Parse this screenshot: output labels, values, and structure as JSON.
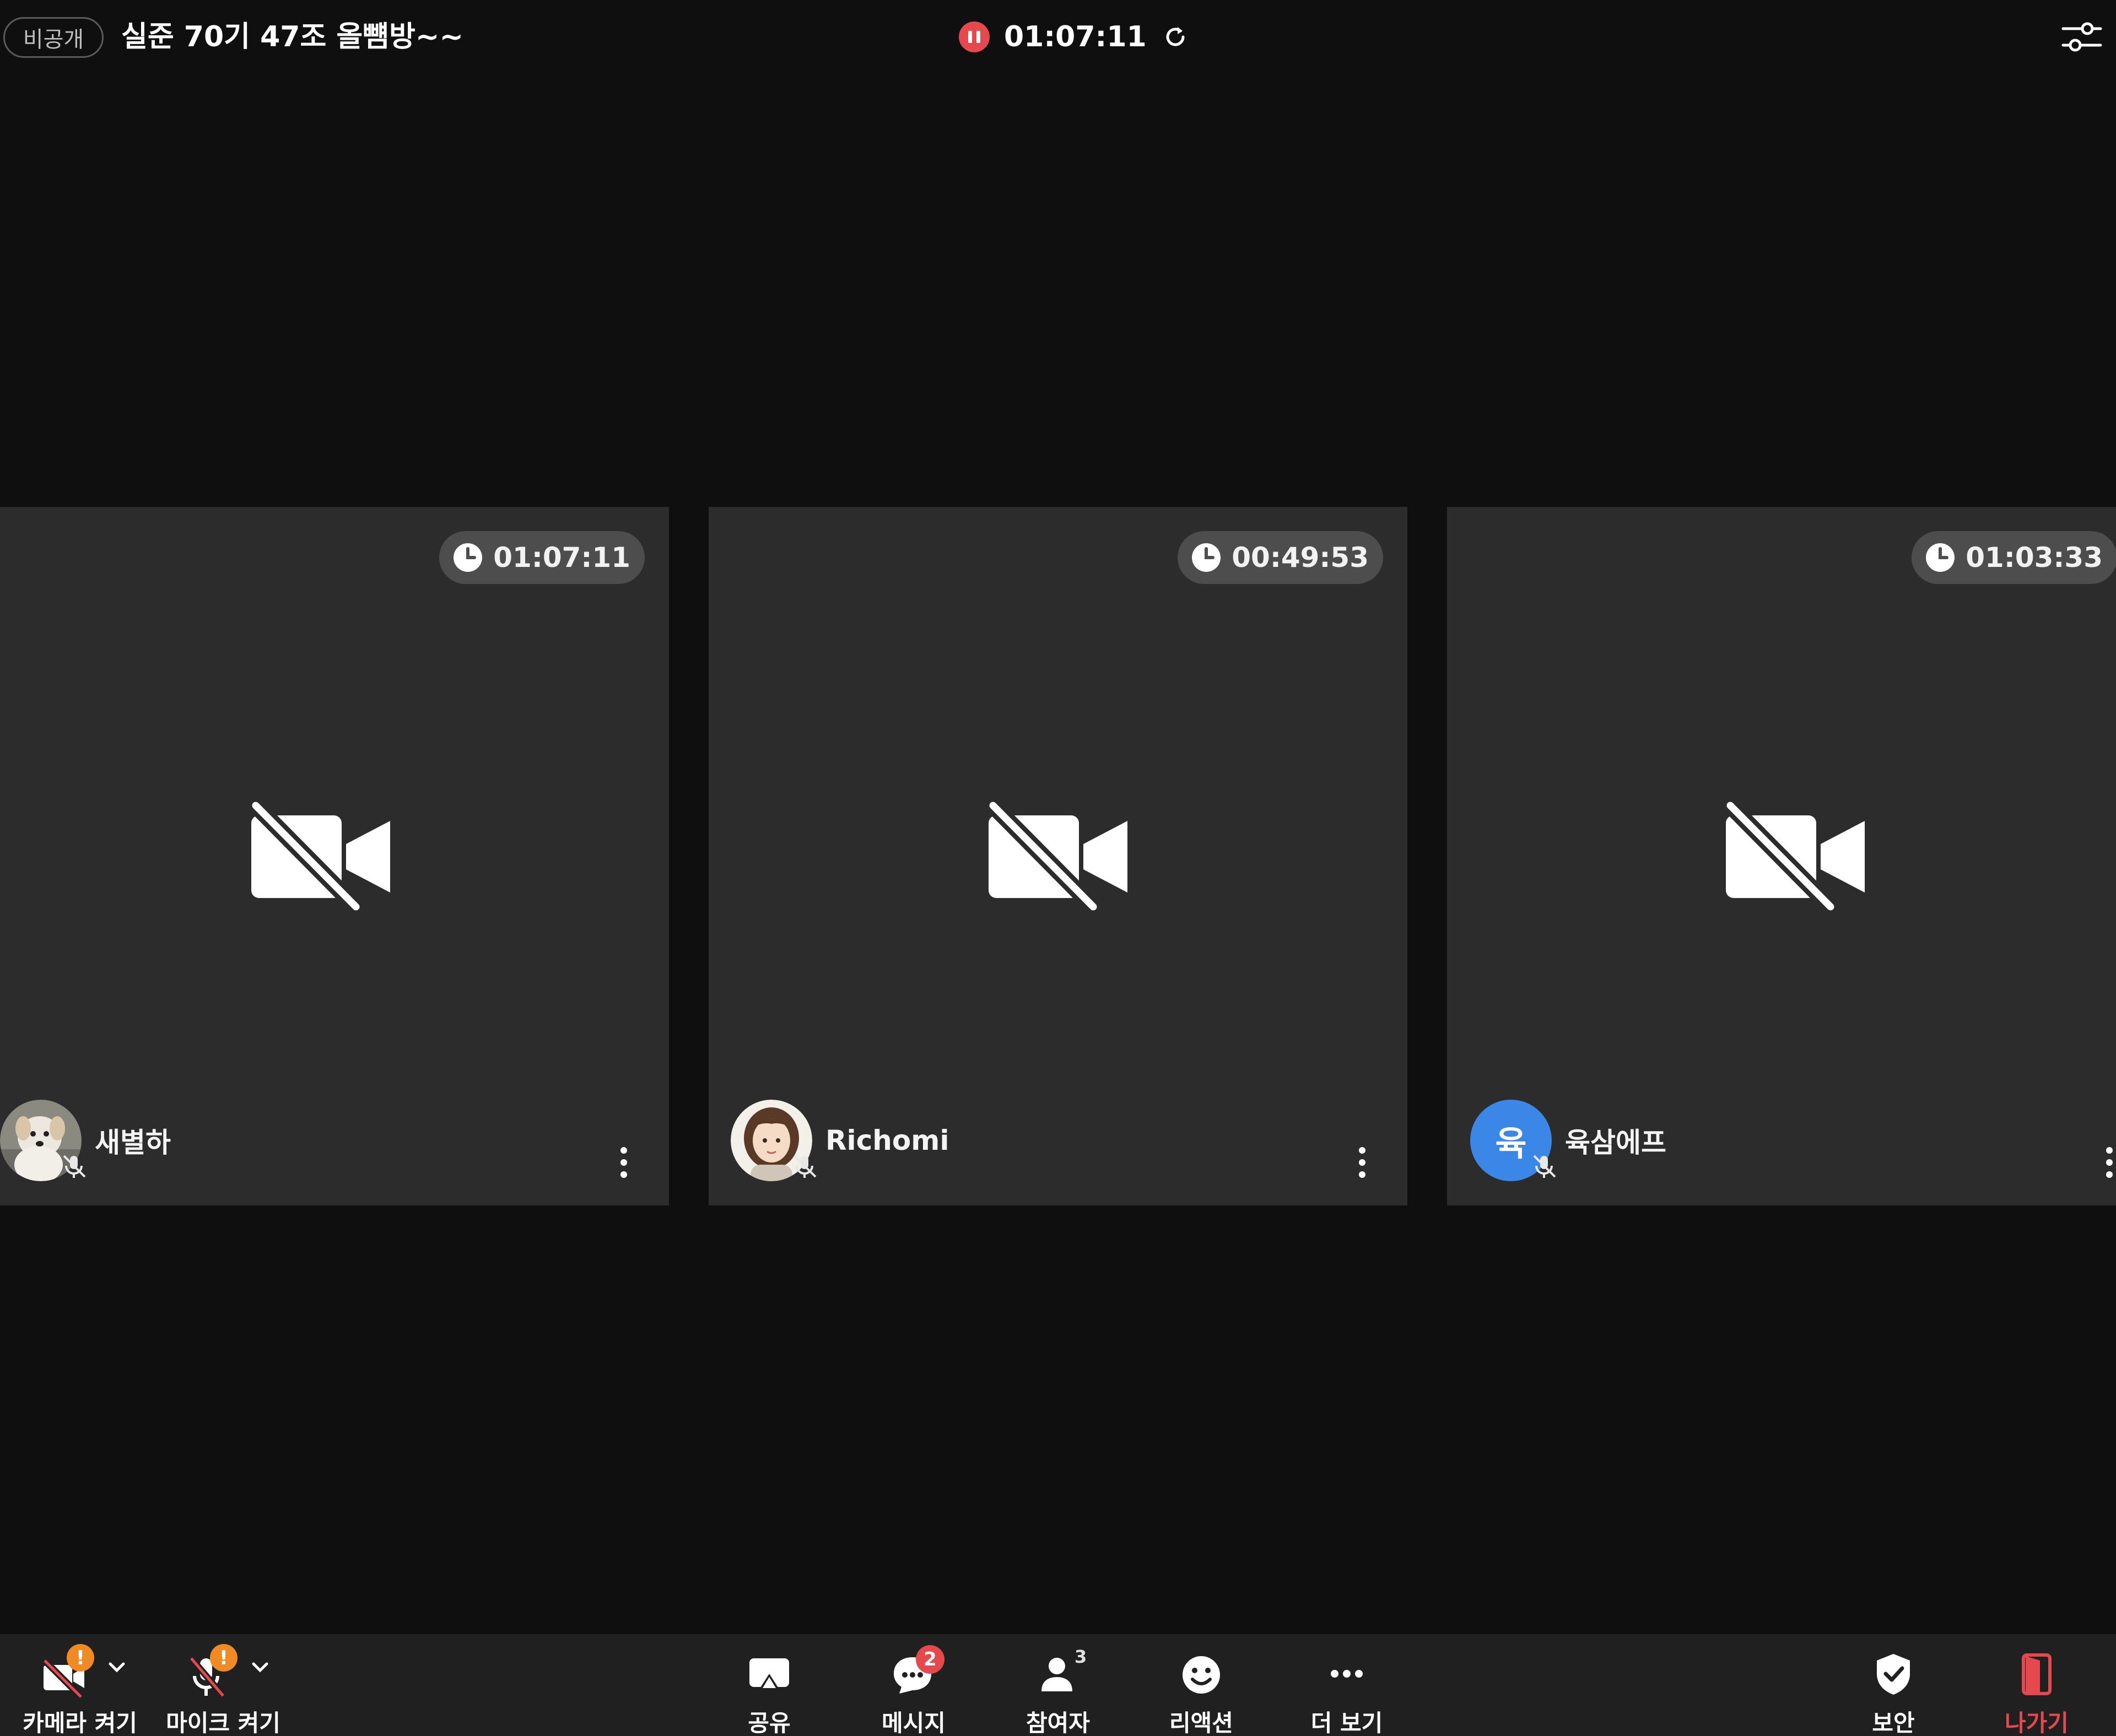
{
  "header": {
    "privacy_label": "비공개",
    "room_title": "실준 70기 47조 올뻄방~~",
    "recording_time": "01:07:11",
    "icons": {
      "recording": "pause-recording-icon",
      "refresh": "refresh-icon",
      "settings": "settings-sliders-icon"
    }
  },
  "participants": [
    {
      "name": "새별하",
      "duration": "01:07:11",
      "avatar_type": "photo-dog",
      "muted": true
    },
    {
      "name": "Richomi",
      "duration": "00:49:53",
      "avatar_type": "photo-illustration",
      "muted": true
    },
    {
      "name": "육삼에프",
      "duration": "01:03:33",
      "avatar_type": "letter",
      "avatar_letter": "육",
      "avatar_color": "#3b87e8",
      "muted": true
    }
  ],
  "toolbar": {
    "camera_label": "카메라 켜기",
    "mic_label": "마이크 켜기",
    "share_label": "공유",
    "message_label": "메시지",
    "message_badge": "2",
    "participants_label": "참여자",
    "participants_count": "3",
    "reaction_label": "리액션",
    "more_label": "더 보기",
    "security_label": "보안",
    "leave_label": "나가기",
    "warning_mark": "!"
  },
  "colors": {
    "background": "#0f0f0f",
    "tile": "#2c2c2c",
    "toolbar": "#202020",
    "accent_red": "#e5484d",
    "warning_orange": "#f08a24",
    "avatar_blue": "#3b87e8"
  }
}
